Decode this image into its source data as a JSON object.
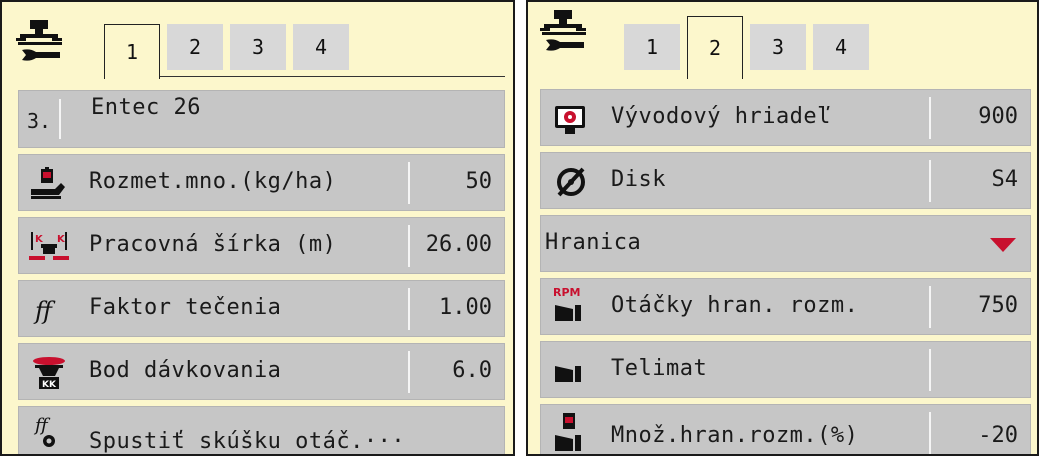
{
  "left": {
    "tabs": [
      "1",
      "2",
      "3",
      "4"
    ],
    "active_tab": 0,
    "rows": [
      {
        "prefix": "3.",
        "label": "Entec 26"
      },
      {
        "icon": "weight-icon",
        "label": "Rozmet.mno.(kg/ha)",
        "value": "50"
      },
      {
        "icon": "working-width-icon",
        "label": "Pracovná šírka (m)",
        "value": "26.00"
      },
      {
        "icon": "flow-factor-icon",
        "label": "Faktor tečenia",
        "value": "1.00"
      },
      {
        "icon": "drop-point-icon",
        "label": "Bod dávkovania",
        "value": "6.0"
      },
      {
        "icon": "test-flow-icon",
        "label": "Spustiť skúšku otáč.···"
      }
    ]
  },
  "right": {
    "tabs": [
      "1",
      "2",
      "3",
      "4"
    ],
    "active_tab": 1,
    "rows": [
      {
        "icon": "pto-shaft-icon",
        "label": "Vývodový hriadeľ",
        "value": "900"
      },
      {
        "icon": "disc-icon",
        "label": "Disk",
        "value": "S4"
      },
      {
        "label": "Hranica",
        "dropdown": true
      },
      {
        "icon": "rpm-border-icon",
        "rpm": "RPM",
        "label": "Otáčky hran. rozm.",
        "value": "750"
      },
      {
        "icon": "telimat-icon",
        "label": "Telimat",
        "value": ""
      },
      {
        "icon": "border-quantity-icon",
        "label": "Množ.hran.rozm.(%)",
        "value": "-20"
      }
    ]
  },
  "colors": {
    "panel": "#fcf7cc",
    "row": "#c6c6c6",
    "accent": "#c8102e"
  }
}
